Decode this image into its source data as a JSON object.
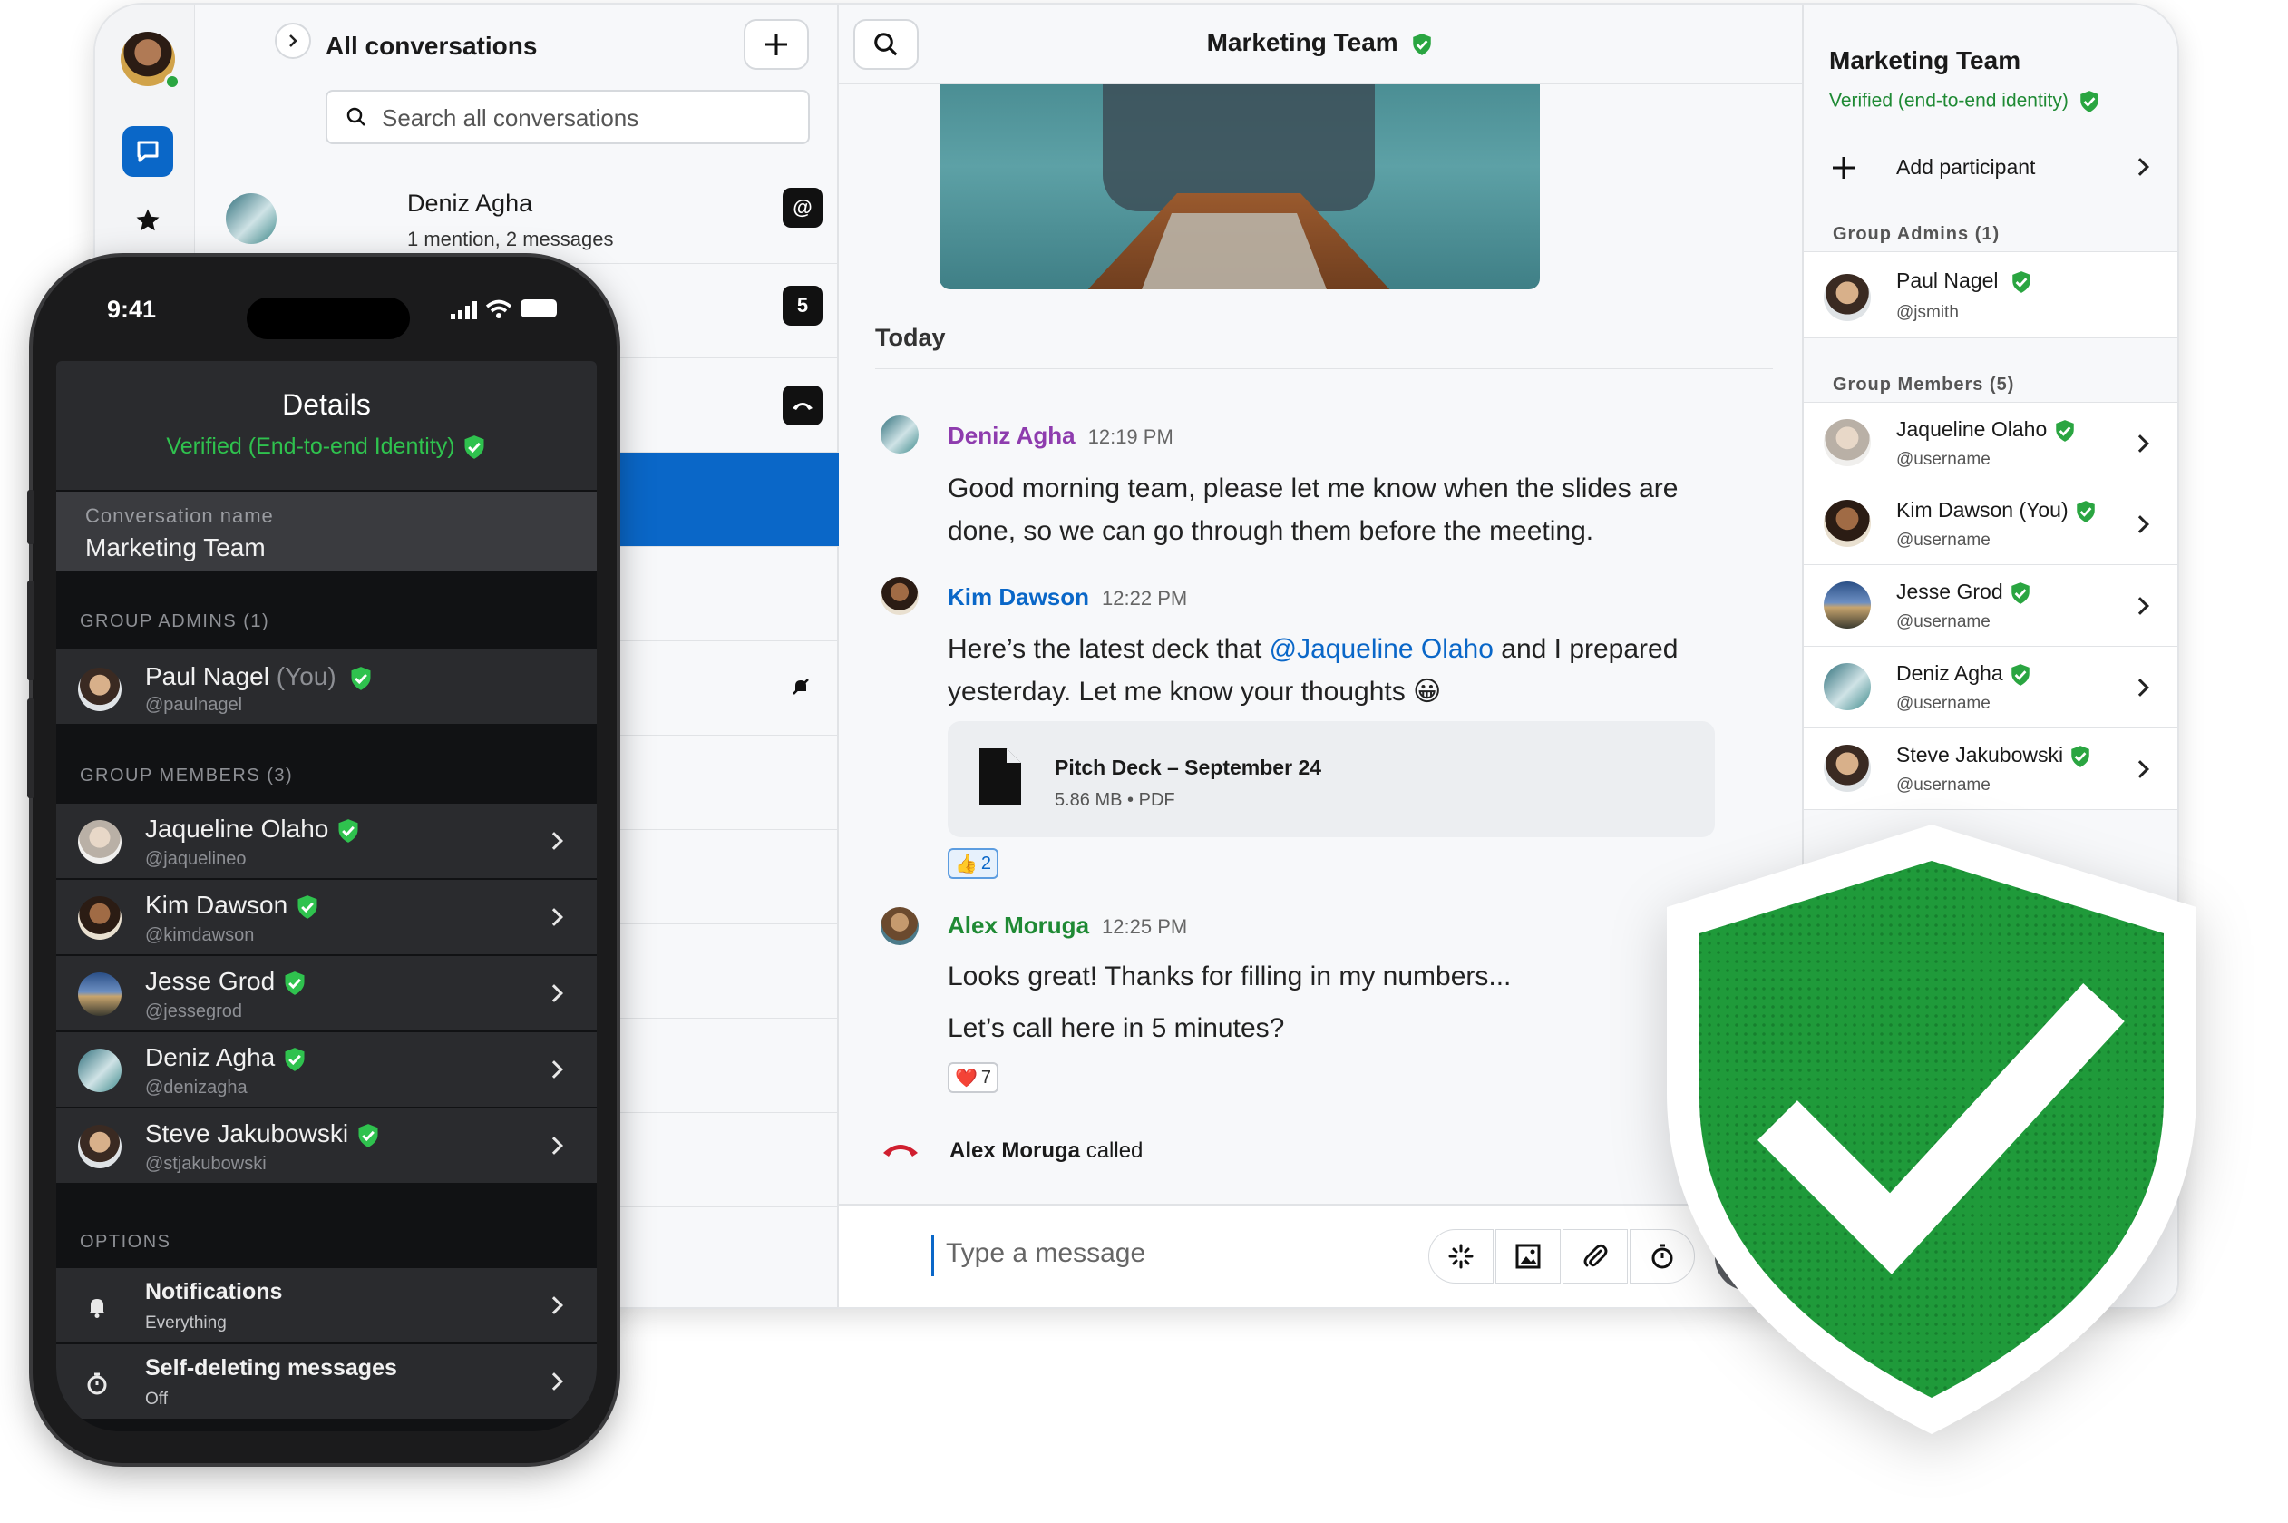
{
  "sidebar": {
    "header_title": "All conversations",
    "search_placeholder": "Search all conversations",
    "conversations": [
      {
        "name": "Deniz Agha",
        "subtitle": "1 mention, 2 messages",
        "badge": "@"
      },
      {
        "badge": "5"
      }
    ]
  },
  "chat": {
    "title": "Marketing Team",
    "day_label": "Today",
    "messages": [
      {
        "author": "Deniz Agha",
        "time": "12:19 PM",
        "color": "#8e3cae",
        "text": "Good morning team, please let me know when the slides are done, so we can go through them before the meeting."
      },
      {
        "author": "Kim Dawson",
        "time": "12:22 PM",
        "color": "#0a67c8",
        "text_before": "Here’s the latest deck that ",
        "mention": "@Jaqueline Olaho",
        "text_after": " and I prepared yesterday. Let me know your thoughts 😀",
        "attachment": {
          "name": "Pitch Deck – September 24",
          "meta": "5.86 MB • PDF"
        },
        "reaction": {
          "emoji": "👍",
          "count": "2"
        }
      },
      {
        "author": "Alex Moruga",
        "time": "12:25 PM",
        "color": "#1f8a34",
        "text": "Looks great! Thanks for filling in my numbers...",
        "text2": "Let’s call here in 5 minutes?",
        "reaction": {
          "emoji": "❤️",
          "count": "7"
        }
      }
    ],
    "call_event": {
      "who": "Alex Moruga",
      "what": " called"
    },
    "composer_placeholder": "Type a message"
  },
  "details": {
    "title": "Marketing Team",
    "verified_text": "Verified (end-to-end identity)",
    "add_participant": "Add participant",
    "admins_header": "Group Admins (1)",
    "admins": [
      {
        "name": "Paul Nagel",
        "username": "@jsmith"
      }
    ],
    "members_header": "Group Members (5)",
    "members": [
      {
        "name": "Jaqueline Olaho",
        "username": "@username"
      },
      {
        "name": "Kim Dawson (You)",
        "username": "@username"
      },
      {
        "name": "Jesse Grod",
        "username": "@username"
      },
      {
        "name": "Deniz Agha",
        "username": "@username"
      },
      {
        "name": "Steve Jakubowski",
        "username": "@username"
      }
    ]
  },
  "phone": {
    "time": "9:41",
    "title": "Details",
    "verified_text": "Verified (End-to-end Identity)",
    "conv_name_label": "Conversation name",
    "conv_name": "Marketing Team",
    "admins_header": "GROUP ADMINS (1)",
    "admin": {
      "name": "Paul Nagel",
      "you": " (You)",
      "username": "@paulnagel"
    },
    "members_header": "GROUP MEMBERS (3)",
    "members": [
      {
        "name": "Jaqueline Olaho",
        "username": "@jaquelineo"
      },
      {
        "name": "Kim Dawson",
        "username": "@kimdawson"
      },
      {
        "name": "Jesse Grod",
        "username": "@jessegrod"
      },
      {
        "name": "Deniz Agha",
        "username": "@denizagha"
      },
      {
        "name": "Steve Jakubowski",
        "username": "@stjakubowski"
      }
    ],
    "options_header": "OPTIONS",
    "options": [
      {
        "label": "Notifications",
        "value": "Everything",
        "icon": "bell-icon"
      },
      {
        "label": "Self-deleting messages",
        "value": "Off",
        "icon": "timer-icon"
      }
    ]
  },
  "colors": {
    "accent": "#0a67c8",
    "verified_green": "#2aa541",
    "shield_green": "#1f9a3a",
    "phone_verified": "#2fc24e"
  }
}
